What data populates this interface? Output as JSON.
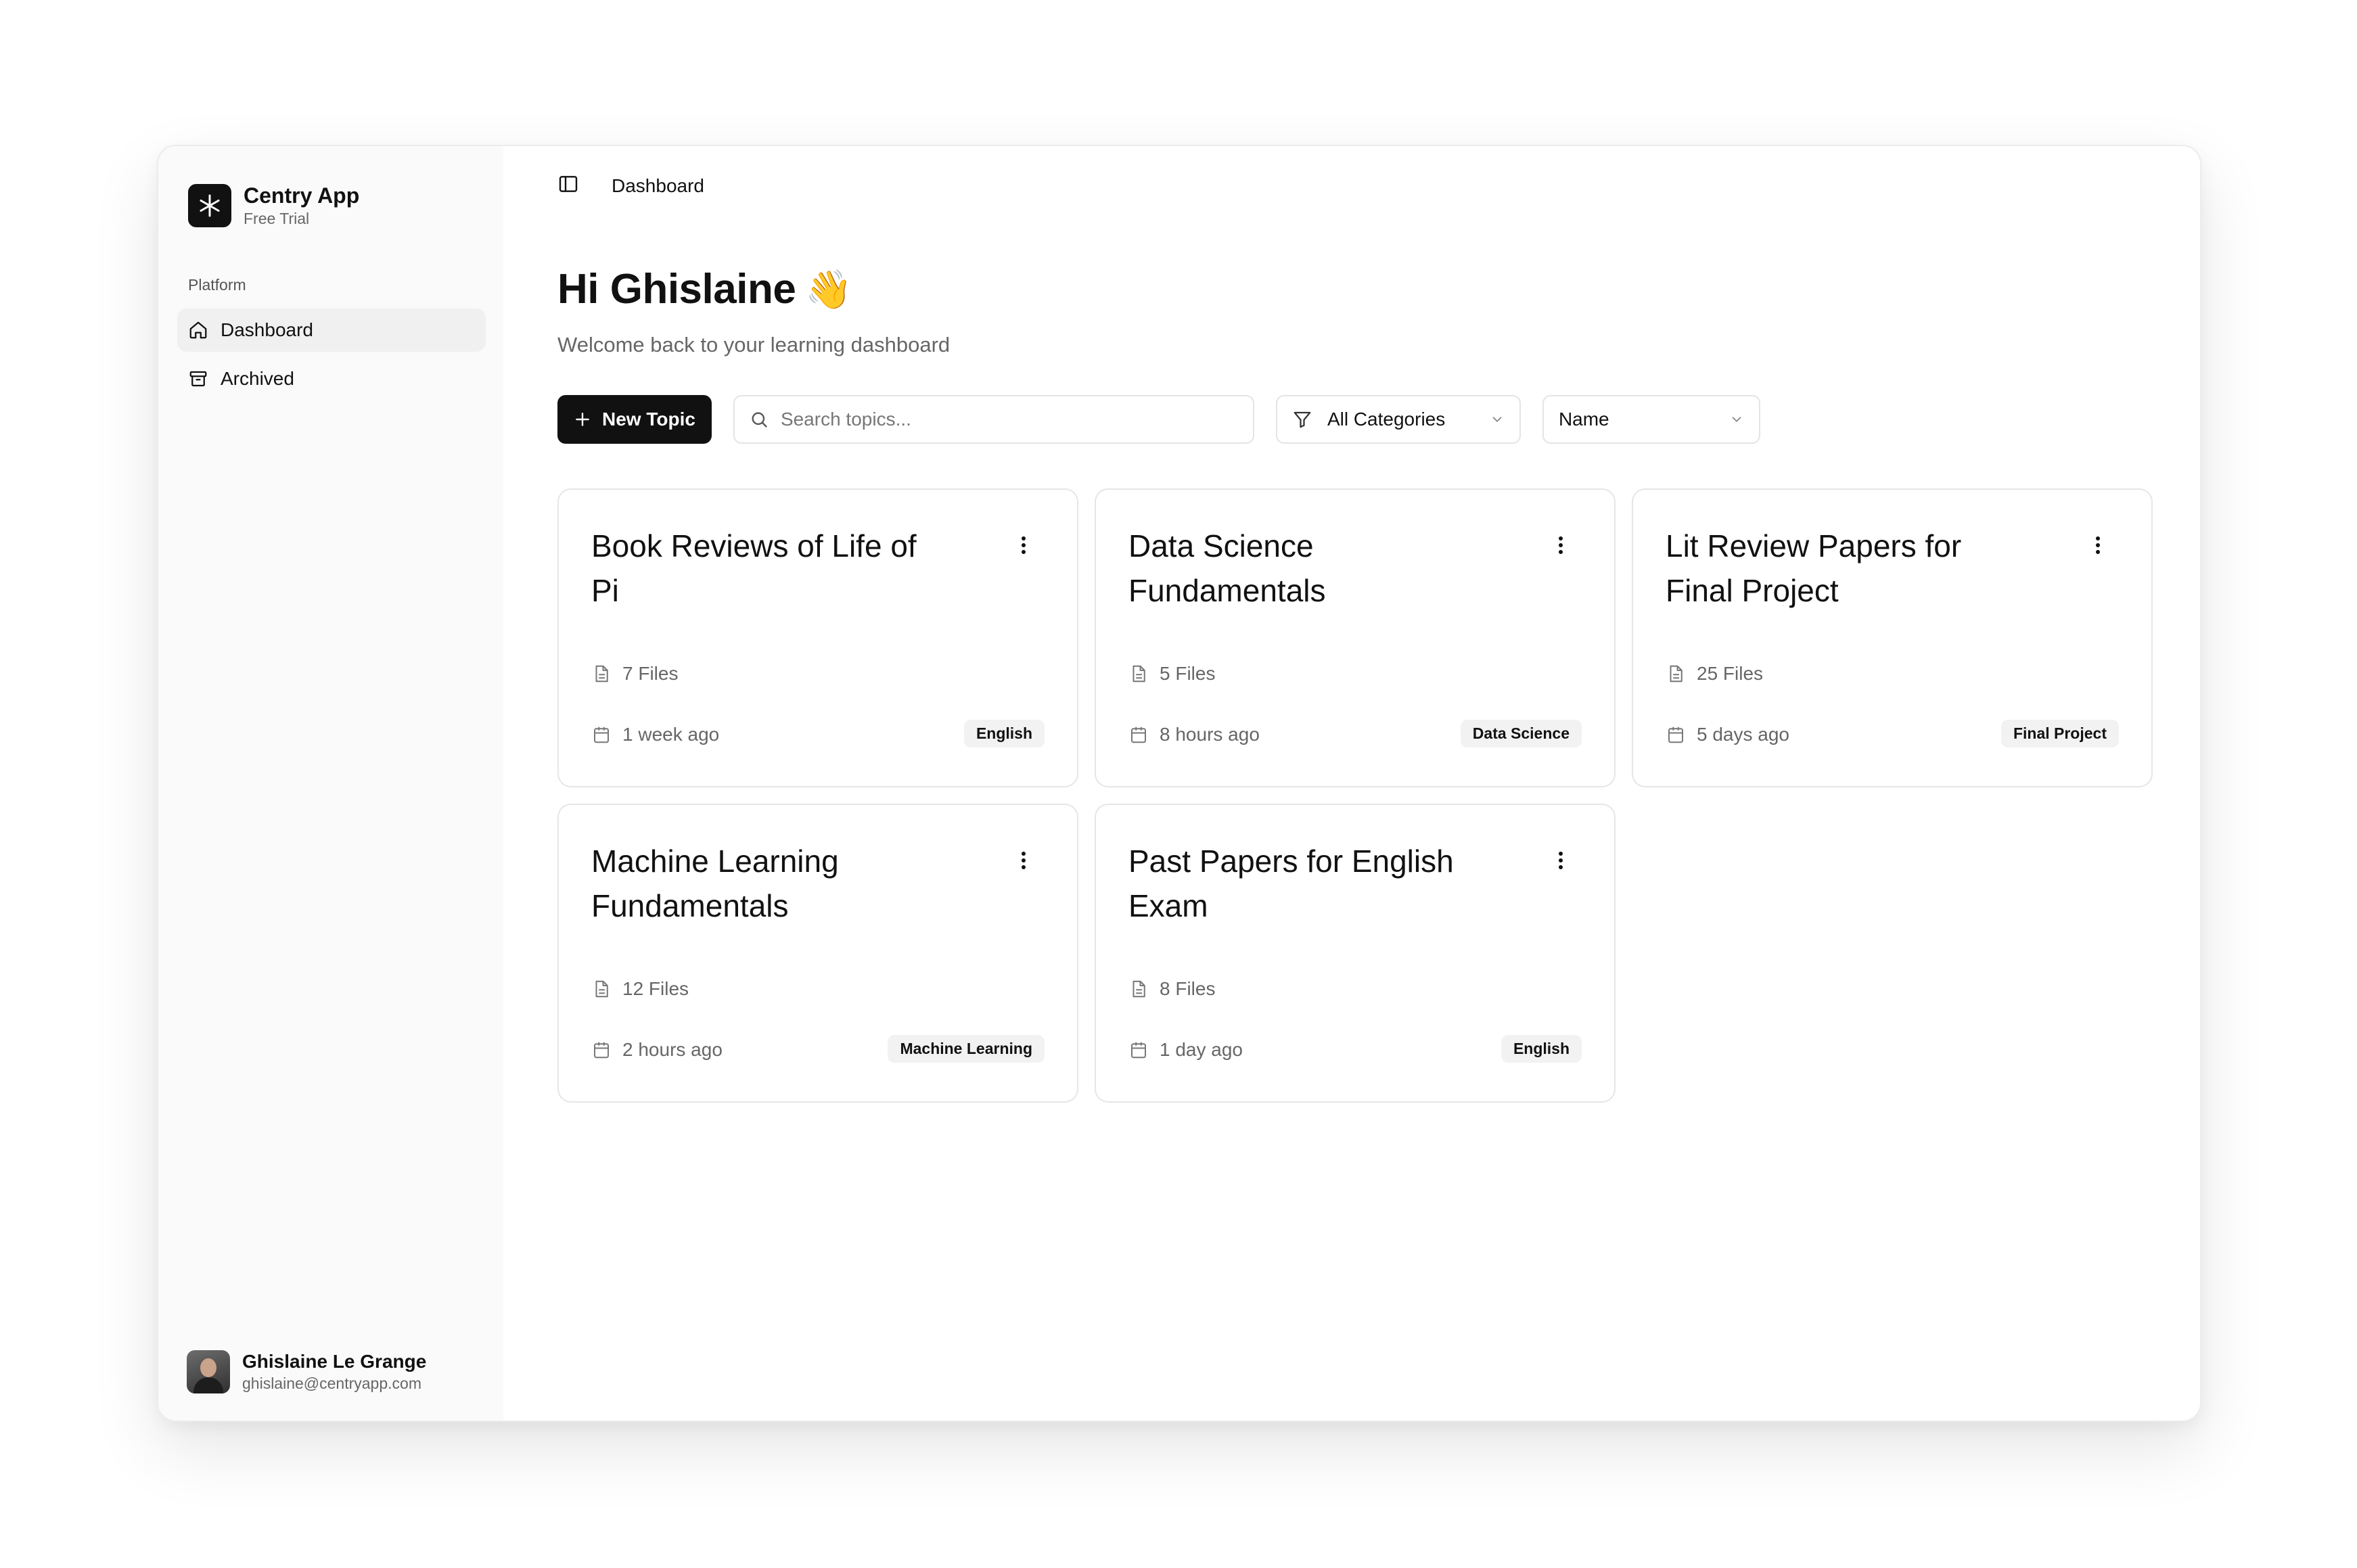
{
  "brand": {
    "name": "Centry App",
    "plan": "Free Trial"
  },
  "sidebar": {
    "section_label": "Platform",
    "items": [
      {
        "label": "Dashboard",
        "icon": "home-icon",
        "active": true
      },
      {
        "label": "Archived",
        "icon": "archive-icon",
        "active": false
      }
    ]
  },
  "user": {
    "name": "Ghislaine Le Grange",
    "email": "ghislaine@centryapp.com"
  },
  "topbar": {
    "breadcrumb": "Dashboard"
  },
  "header": {
    "greeting": "Hi Ghislaine",
    "wave": "👋",
    "subtitle": "Welcome back to your learning dashboard"
  },
  "toolbar": {
    "new_topic_label": "New Topic",
    "search_placeholder": "Search topics...",
    "category_filter": "All Categories",
    "sort": "Name"
  },
  "topics": [
    {
      "title": "Book Reviews of Life of Pi",
      "files": "7 Files",
      "updated": "1 week ago",
      "tag": "English"
    },
    {
      "title": "Data Science Fundamentals",
      "files": "5 Files",
      "updated": "8 hours ago",
      "tag": "Data Science"
    },
    {
      "title": "Lit Review Papers for Final Project",
      "files": "25 Files",
      "updated": "5 days ago",
      "tag": "Final Project"
    },
    {
      "title": "Machine Learning Fundamentals",
      "files": "12 Files",
      "updated": "2 hours ago",
      "tag": "Machine Learning"
    },
    {
      "title": "Past Papers for English Exam",
      "files": "8 Files",
      "updated": "1 day ago",
      "tag": "English"
    }
  ],
  "colors": {
    "primary": "#111111",
    "muted_text": "#666666",
    "border": "#e6e6e6",
    "sidebar_bg": "#fafafa",
    "tag_bg": "#f2f2f2"
  }
}
